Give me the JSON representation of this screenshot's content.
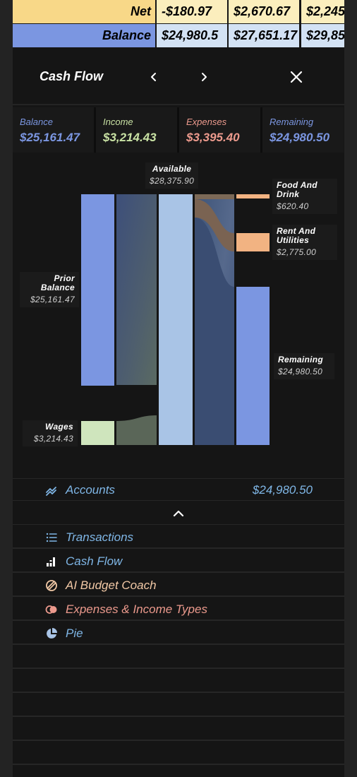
{
  "table": {
    "net_label": "Net",
    "balance_label": "Balance",
    "net_values": [
      "-$180.97",
      "$2,670.67",
      "$2,245"
    ],
    "balance_values": [
      "$24,980.5",
      "$27,651.17",
      "$29,85"
    ]
  },
  "header": {
    "title": "Cash Flow",
    "prev_icon": "chevron-left-icon",
    "next_icon": "chevron-right-icon",
    "close_icon": "close-icon"
  },
  "summary": {
    "balance_label": "Balance",
    "balance_value": "$25,161.47",
    "income_label": "Income",
    "income_value": "$3,214.43",
    "expenses_label": "Expenses",
    "expenses_value": "$3,395.40",
    "remaining_label": "Remaining",
    "remaining_value": "$24,980.50"
  },
  "colors": {
    "balance": "#7b96e1",
    "income": "#c9e2a4",
    "expenses": "#ec9a7d",
    "remaining": "#7b96e1",
    "link": "#7fb6e6",
    "expense_node": "#f2b382",
    "available_node": "#a9c4e6"
  },
  "sankey": {
    "available_name": "Available",
    "available_amount": "$28,375.90",
    "food_name": "Food And Drink",
    "food_amount": "$620.40",
    "rent_name": "Rent And Utilities",
    "rent_amount": "$2,775.00",
    "prior_name": "Prior Balance",
    "prior_amount": "$25,161.47",
    "wages_name": "Wages",
    "wages_amount": "$3,214.43",
    "remaining_name": "Remaining",
    "remaining_amount": "$24,980.50"
  },
  "accounts": {
    "label": "Accounts",
    "value": "$24,980.50",
    "icon": "trend-icon"
  },
  "menu": [
    {
      "label": "Transactions",
      "icon": "list-icon",
      "color": "#7fb6e6"
    },
    {
      "label": "Cash Flow",
      "icon": "cash-flow-icon",
      "color": "#7fb6e6"
    },
    {
      "label": "AI Budget Coach",
      "icon": "coach-icon",
      "color": "#f2c9a6"
    },
    {
      "label": "Expenses & Income Types",
      "icon": "types-icon",
      "color": "#ec9a8d"
    },
    {
      "label": "Pie",
      "icon": "pie-icon",
      "color": "#7fb6e6"
    }
  ]
}
